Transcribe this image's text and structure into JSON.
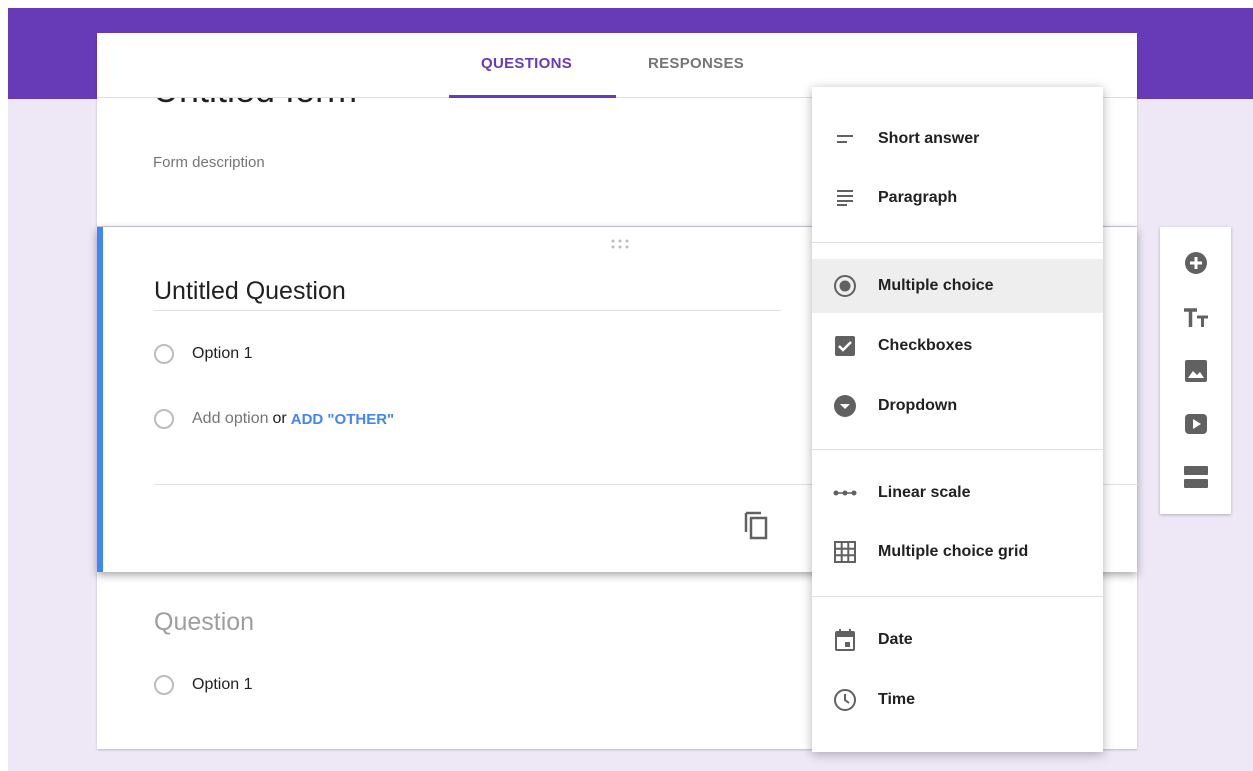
{
  "tabs": {
    "questions": "QUESTIONS",
    "responses": "RESPONSES"
  },
  "form": {
    "title": "Untitled form",
    "description_placeholder": "Form description"
  },
  "active_question": {
    "title": "Untitled Question",
    "options": [
      "Option 1"
    ],
    "add_option": "Add option",
    "or_text": "or",
    "add_other": "ADD \"OTHER\""
  },
  "next_question": {
    "title_placeholder": "Question",
    "options": [
      "Option 1"
    ]
  },
  "question_type_menu": {
    "items": [
      {
        "label": "Short answer",
        "icon": "short-answer-icon"
      },
      {
        "label": "Paragraph",
        "icon": "paragraph-icon"
      },
      {
        "label": "Multiple choice",
        "icon": "radio-button-icon",
        "selected": true
      },
      {
        "label": "Checkboxes",
        "icon": "checkbox-icon"
      },
      {
        "label": "Dropdown",
        "icon": "dropdown-icon"
      },
      {
        "label": "Linear scale",
        "icon": "linear-scale-icon"
      },
      {
        "label": "Multiple choice grid",
        "icon": "grid-icon"
      },
      {
        "label": "Date",
        "icon": "calendar-icon"
      },
      {
        "label": "Time",
        "icon": "clock-icon"
      }
    ]
  },
  "side_toolbar": {
    "tools": [
      "add-question-icon",
      "title-text-icon",
      "image-icon",
      "video-icon",
      "section-icon"
    ]
  },
  "colors": {
    "header": "#673ab7",
    "accent": "#4285f4",
    "background": "#ede7f6"
  }
}
